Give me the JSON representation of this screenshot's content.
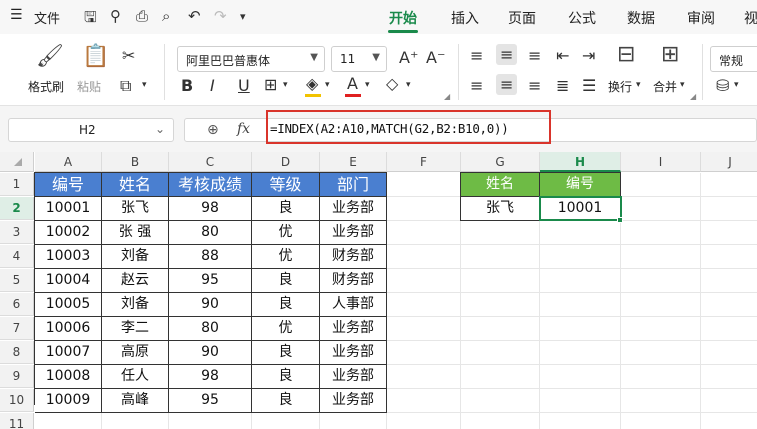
{
  "menubar": {
    "menu_label": "文件",
    "tabs": [
      "开始",
      "插入",
      "页面",
      "公式",
      "数据",
      "审阅",
      "视"
    ],
    "active_tab": "开始"
  },
  "ribbon": {
    "format_painter": "格式刷",
    "paste": "粘贴",
    "font_name": "阿里巴巴普惠体",
    "font_size": "11",
    "wrap": "换行",
    "merge": "合并",
    "number_format": "常规",
    "bold": "B",
    "italic": "I",
    "underline": "U",
    "font_grow": "A⁺",
    "font_shrink": "A⁻",
    "fill_color": "#f2c300",
    "font_color": "#e02020"
  },
  "formula_bar": {
    "name_box": "H2",
    "fx": "fx",
    "formula": "=INDEX(A2:A10,MATCH(G2,B2:B10,0))"
  },
  "columns": [
    "A",
    "B",
    "C",
    "D",
    "E",
    "F",
    "G",
    "H",
    "I",
    "J"
  ],
  "rows": [
    "1",
    "2",
    "3",
    "4",
    "5",
    "6",
    "7",
    "8",
    "9",
    "10",
    "11"
  ],
  "table": {
    "headers": [
      "编号",
      "姓名",
      "考核成绩",
      "等级",
      "部门"
    ],
    "rows": [
      [
        "10001",
        "张飞",
        "98",
        "良",
        "业务部"
      ],
      [
        "10002",
        "张 强",
        "80",
        "优",
        "业务部"
      ],
      [
        "10003",
        "刘备",
        "88",
        "优",
        "财务部"
      ],
      [
        "10004",
        "赵云",
        "95",
        "良",
        "财务部"
      ],
      [
        "10005",
        "刘备",
        "90",
        "良",
        "人事部"
      ],
      [
        "10006",
        "李二",
        "80",
        "优",
        "业务部"
      ],
      [
        "10007",
        "高原",
        "90",
        "良",
        "业务部"
      ],
      [
        "10008",
        "任人",
        "98",
        "良",
        "业务部"
      ],
      [
        "10009",
        "高峰",
        "95",
        "良",
        "业务部"
      ]
    ]
  },
  "lookup": {
    "header_name": "姓名",
    "header_id": "编号",
    "name_value": "张飞",
    "id_value": "10001"
  },
  "colors": {
    "accent": "#1a8a4b",
    "table_header_bg": "#4a7fd0",
    "lookup_header_bg": "#6ebb45",
    "formula_highlight": "#d9342b"
  }
}
